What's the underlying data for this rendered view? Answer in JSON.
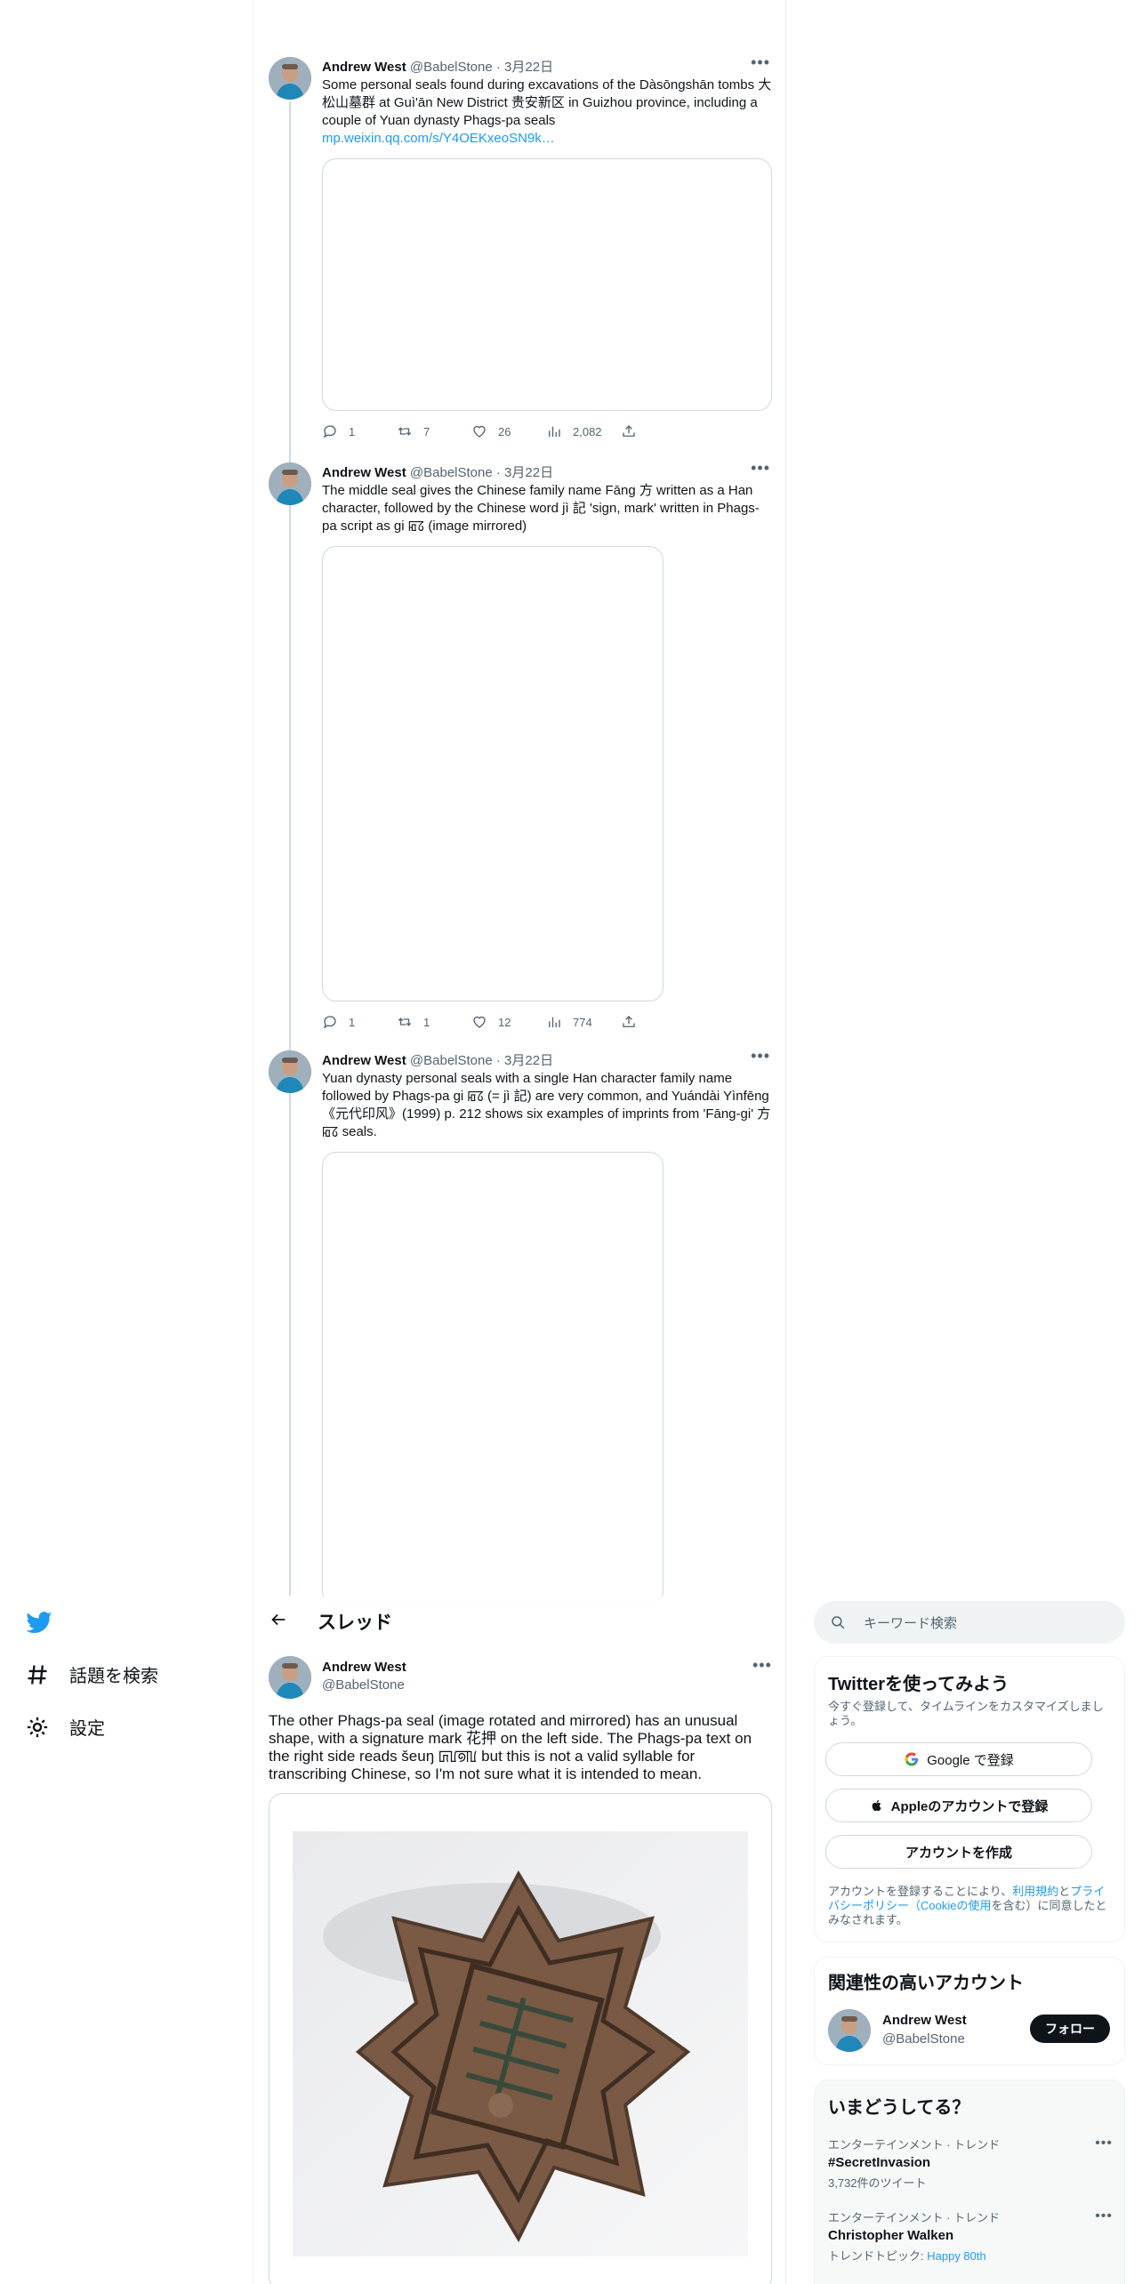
{
  "nav": {
    "explore_label": "話題を検索",
    "settings_label": "設定"
  },
  "header": {
    "title": "スレッド"
  },
  "tweets": [
    {
      "name": "Andrew West",
      "handle": "@BabelStone",
      "date": "· 3月22日",
      "text": "Some personal seals found during excavations of the Dàsōngshān tombs 大松山墓群 at Guì'ān New District 贵安新区 in Guizhou province, including a couple of Yuan dynasty Phags-pa seals",
      "link": "mp.weixin.qq.com/s/Y4OEKxeoSN9k…",
      "replies": "1",
      "retweets": "7",
      "likes": "26",
      "views": "2,082"
    },
    {
      "name": "Andrew West",
      "handle": "@BabelStone",
      "date": "· 3月22日",
      "text": "The middle seal gives the Chinese family name Fāng 方 written as a Han character, followed by the Chinese word jì 記 'sign, mark' written in Phags-pa script as gi ꡂꡞ (image mirrored)",
      "replies": "1",
      "retweets": "1",
      "likes": "12",
      "views": "774"
    },
    {
      "name": "Andrew West",
      "handle": "@BabelStone",
      "date": "· 3月22日",
      "text": "Yuan dynasty personal seals with a single Han character family name followed by Phags-pa gi ꡂꡞ (= jì 記) are very common, and Yuándài Yìnfēng 《元代印风》(1999) p. 212 shows six examples of imprints from 'Fāng-gi' 方 ꡂꡞ seals."
    }
  ],
  "focal": {
    "name": "Andrew West",
    "handle": "@BabelStone",
    "text": "The other Phags-pa seal (image rotated and mirrored) has an unusual shape, with a signature mark 花押 on the left side. The Phags-pa text on the right side reads šeuŋ ꡚꡦꡟꡃ but this is not a valid syllable for transcribing Chinese, so I'm not sure what it is intended to mean."
  },
  "sidebar": {
    "search_placeholder": "キーワード検索",
    "signup": {
      "title": "Twitterを使ってみよう",
      "subtitle": "今すぐ登録して、タイムラインをカスタマイズしましょう。",
      "google_button": "Google で登録",
      "apple_button": "Appleのアカウントで登録",
      "create_button": "アカウントを作成",
      "legal_pre": "アカウントを登録することにより、",
      "terms": "利用規約",
      "and": "と",
      "privacy": "プライバシーポリシー（Cookieの使用",
      "legal_post": "を含む）に同意したとみなされます。"
    },
    "related": {
      "title": "関連性の高いアカウント",
      "name": "Andrew West",
      "handle": "@BabelStone",
      "follow": "フォロー"
    },
    "trends": {
      "title": "いまどうしてる？",
      "items": [
        {
          "category": "エンターテインメント · トレンド",
          "name": "#SecretInvasion",
          "meta": "3,732件のツイート"
        },
        {
          "category": "エンターテインメント · トレンド",
          "name": "Christopher Walken",
          "meta_prefix": "トレンドトピック: ",
          "meta_link": "Happy 80th"
        }
      ]
    }
  },
  "colors": {
    "brand": "#1d9bf0",
    "text": "#0f1419",
    "muted": "#536471",
    "border": "#cfd9de"
  }
}
